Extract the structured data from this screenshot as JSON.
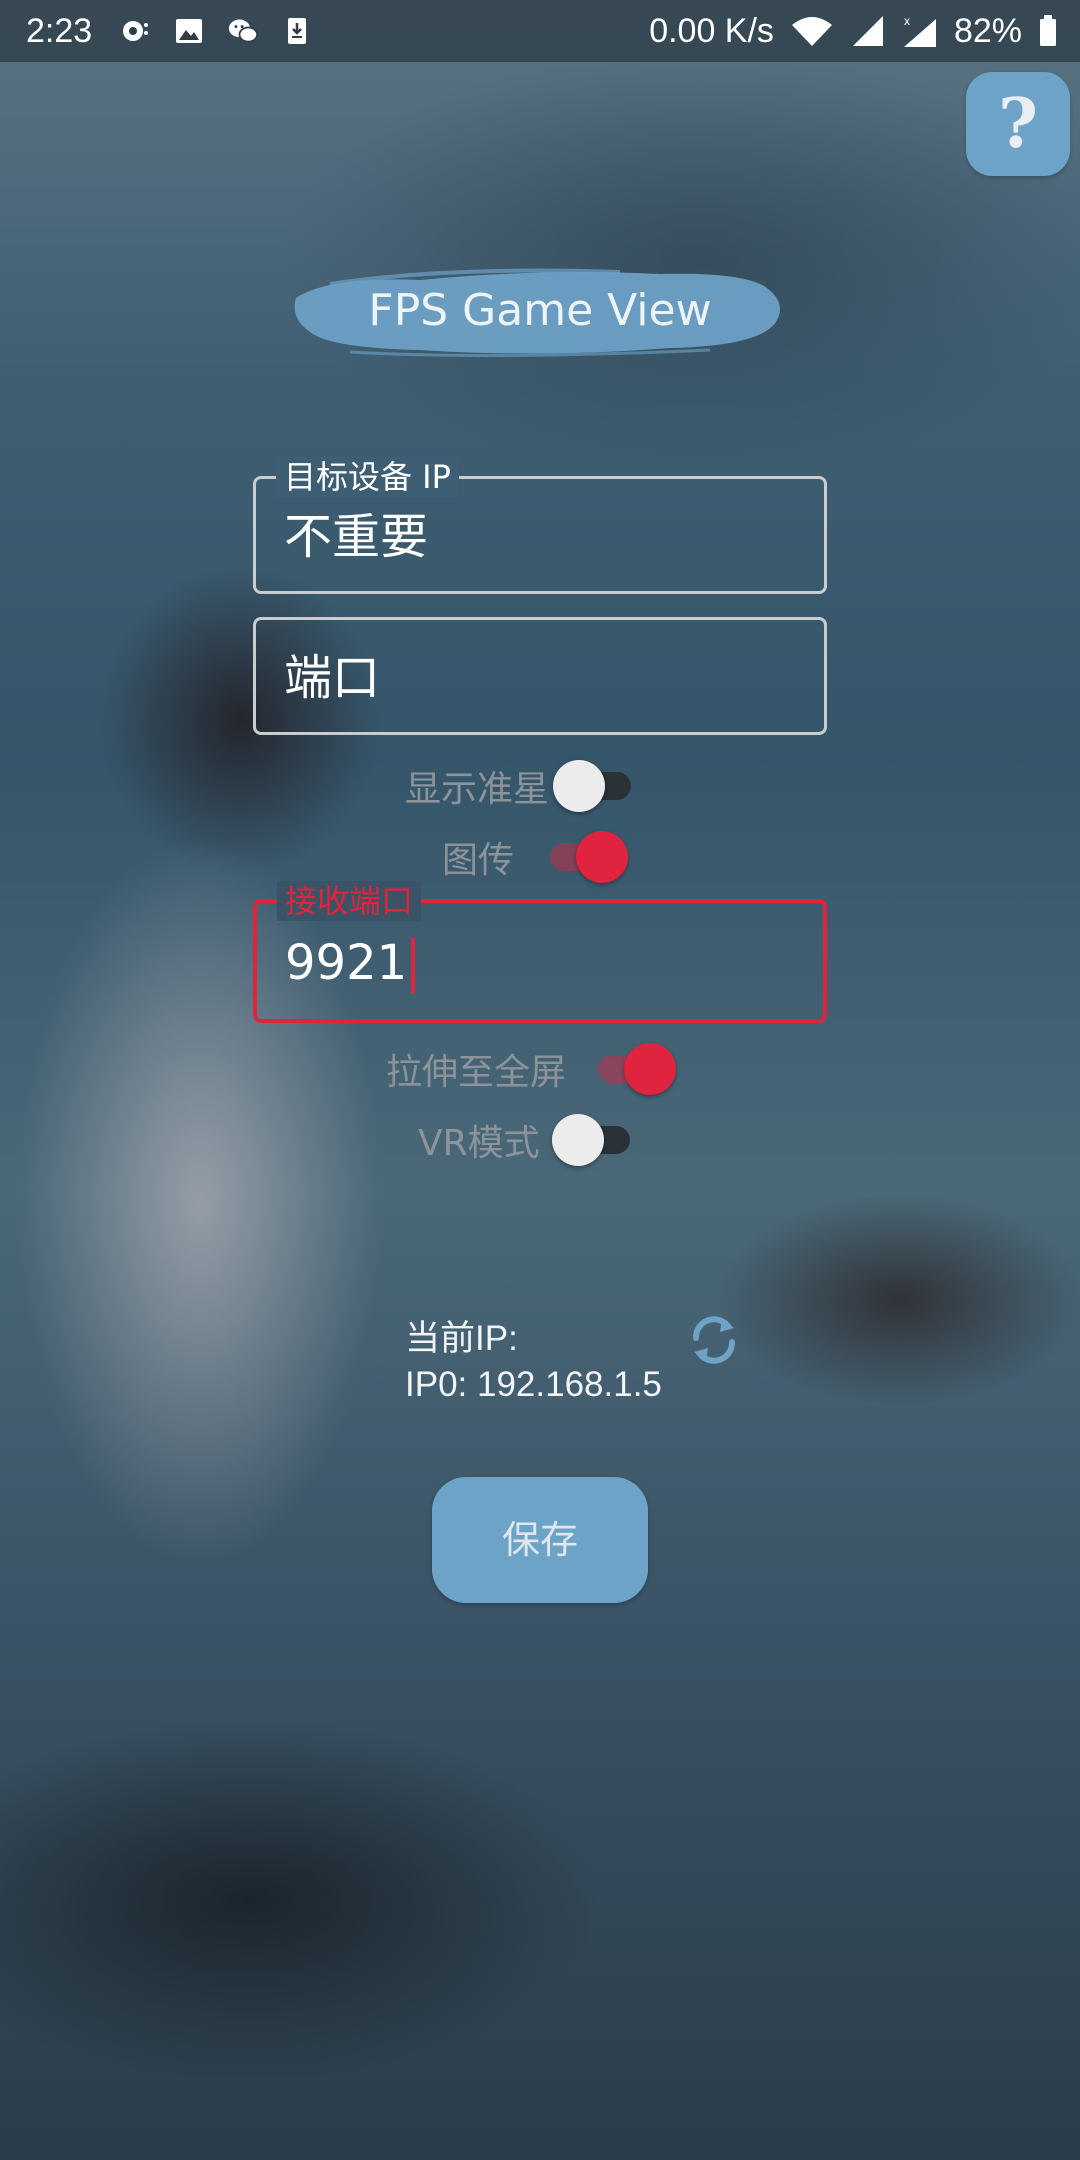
{
  "status_bar": {
    "time": "2:23",
    "net_speed": "0.00 K/s",
    "battery": "82%",
    "icons": [
      "notification-icon",
      "image-icon",
      "wechat-icon",
      "download-icon",
      "wifi-icon",
      "signal-icon",
      "signal-icon-2",
      "battery-icon"
    ]
  },
  "help": {
    "label": "?"
  },
  "title": "FPS Game View",
  "target_ip": {
    "legend": "目标设备 IP",
    "value": "不重要"
  },
  "port": {
    "value": "端口"
  },
  "crosshair": {
    "label": "显示准星",
    "on": false
  },
  "image_transfer": {
    "label": "图传",
    "on": true
  },
  "receive_port": {
    "legend": "接收端口",
    "value": "9921"
  },
  "stretch": {
    "label": "拉伸至全屏",
    "on": true
  },
  "vr": {
    "label": "VR模式",
    "on": false
  },
  "ip_info": {
    "label": "当前IP:",
    "value": "IP0: 192.168.1.5"
  },
  "save": {
    "label": "保存"
  },
  "colors": {
    "accent": "#e0233f",
    "button": "#6ea3c8"
  }
}
